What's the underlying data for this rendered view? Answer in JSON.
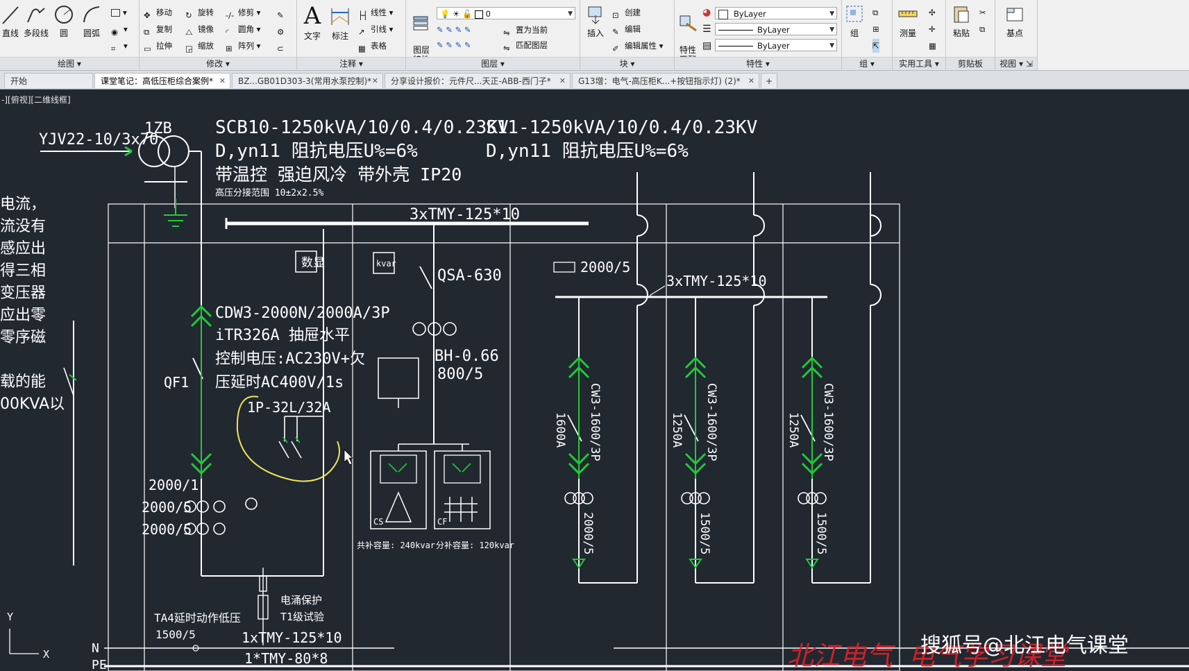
{
  "ribbon": {
    "draw": {
      "title": "绘图",
      "line": "直线",
      "polyline": "多段线",
      "circle": "圆",
      "arc": "圆弧"
    },
    "modify": {
      "title": "修改",
      "move": "移动",
      "rotate": "旋转",
      "trim": "修剪",
      "copy": "复制",
      "mirror": "镜像",
      "fillet": "圆角",
      "stretch": "拉伸",
      "scale": "缩放",
      "array": "阵列"
    },
    "annotation": {
      "title": "注释",
      "text": "文字",
      "dimension": "标注",
      "linear": "线性",
      "leader": "引线",
      "table": "表格"
    },
    "layers": {
      "title": "图层",
      "layer_props": "图层\n特性",
      "current_layer": "0",
      "set_current": "置为当前",
      "match_layer": "匹配图层"
    },
    "block": {
      "title": "块",
      "insert": "插入",
      "create": "创建",
      "edit": "编辑",
      "edit_attr": "编辑属性"
    },
    "properties": {
      "title": "特性",
      "match": "特性\n匹配",
      "color": "ByLayer",
      "linetype": "ByLayer",
      "lineweight": "ByLayer"
    },
    "groups": {
      "title": "组",
      "group": "组"
    },
    "utilities": {
      "title": "实用工具",
      "measure": "测量"
    },
    "clipboard": {
      "title": "剪贴板",
      "paste": "粘贴"
    },
    "view": {
      "title": "视图",
      "base": "基点"
    }
  },
  "tabs": [
    {
      "label": "开始",
      "active": false
    },
    {
      "label": "课堂笔记：高低压柜综合案例*",
      "active": true
    },
    {
      "label": "BZ...GB01D303-3(常用水泵控制)*",
      "active": false
    },
    {
      "label": "分享设计报价：元件尺...天正-ABB-西门子*",
      "active": false
    },
    {
      "label": "G13增：电气-高压柜K...+按钮指示灯) (2)*",
      "active": false
    }
  ],
  "viewport_label": "-][俯视][二维线框]",
  "side_notes": [
    "电流，",
    "流没有",
    "感应出",
    "得三相",
    "变压器",
    "应出零",
    "零序磁",
    "载的能",
    "00KVA以"
  ],
  "drawing": {
    "cable": "YJV22-10/3x70",
    "tr_id": "1ZB",
    "tr1_spec": "SCB10-1250kVA/10/0.4/0.23KV",
    "tr1_conn": "D,yn11  阻抗电压U%=6%",
    "tr1_extra": "带温控  强迫风冷  带外壳  IP20",
    "tap_range": "高压分接范围 10±2x2.5%",
    "tr2_spec": "S11-1250kVA/10/0.4/0.23KV",
    "tr2_conn": "D,yn11  阻抗电压U%=6%",
    "busbar": "3xTMY-125*10",
    "meter_label": "数显",
    "kvar_label": "kvar",
    "breaker1": "CDW3-2000N/2000A/3P",
    "breaker2": "iTR326A  抽屉水平",
    "breaker3": "控制电压:AC230V+欠",
    "breaker4": "压延时AC400V/1s",
    "qf": "QF1",
    "mcb": "1P-32L/32A",
    "ct1": "2000/1",
    "ct2": "2000/5",
    "ct3": "2000/5",
    "qsa": "QSA-630",
    "bh": "BH-0.66",
    "bh_ratio": "800/5",
    "cs": "CS",
    "cf": "CF",
    "comp_common": "共补容量: 240kvar",
    "comp_split": "分补容量: 120kvar",
    "ct_top": "2000/5",
    "bus2": "3xTMY-125*10",
    "feeders": [
      {
        "breaker": "CW3-1600/3P",
        "rating": "1600A",
        "ct": "2000/5"
      },
      {
        "breaker": "CW3-1600/3P",
        "rating": "1250A",
        "ct": "1500/5"
      },
      {
        "breaker": "CW3-1600/3P",
        "rating": "1250A",
        "ct": "1500/5"
      }
    ],
    "surge1": "电涌保护",
    "surge2": "T1级试验",
    "ta4": "TA4延时动作低压",
    "ta4_ratio": "1500/5",
    "n_bus": "1xTMY-125*10",
    "pe_bus": "1*TMY-80*8",
    "n_label": "N",
    "pe_label": "PE",
    "ucs_y": "Y",
    "ucs_x": "X",
    "red_stamp": "北江电气  电气学习课堂"
  },
  "watermark": "搜狐号@北江电气课堂"
}
